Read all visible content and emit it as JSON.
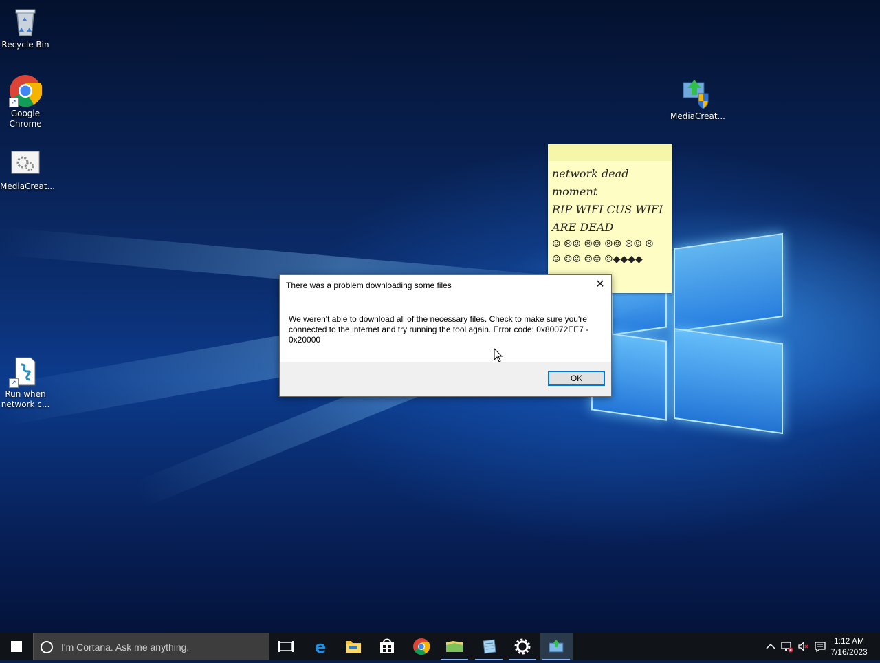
{
  "desktop": {
    "icons": [
      {
        "label": "Recycle Bin"
      },
      {
        "label": "Google Chrome"
      },
      {
        "label": "MediaCreat..."
      },
      {
        "label": "Run when network c..."
      },
      {
        "label": "MediaCreat..."
      }
    ]
  },
  "sticky_note": {
    "text": "network dead\nmoment\nRIP WIFI CUS WIFI\nARE DEAD",
    "emoji_line1": "☺ ☹☺ ☹☺ ☹☺ ☹☺ ☹",
    "emoji_line2": "☺ ☹☺ ☹☺ ☹◆◆◆◆"
  },
  "dialog": {
    "title": "There was a problem downloading some files",
    "message": "We weren't able to download all of the necessary files. Check to make sure you're connected to the internet and try running the tool again. Error code: 0x80072EE7 - 0x20000",
    "ok_label": "OK",
    "close_glyph": "✕"
  },
  "taskbar": {
    "search_placeholder": "I'm Cortana. Ask me anything.",
    "time": "1:12 AM",
    "date": "7/16/2023",
    "apps": [
      "task-view",
      "edge",
      "file-explorer",
      "store",
      "chrome",
      "folder",
      "notepad",
      "settings",
      "media-creation-tool"
    ]
  },
  "colors": {
    "taskbar": "#101418",
    "accent": "#0078d7",
    "sticky": "#fdfdc4"
  }
}
